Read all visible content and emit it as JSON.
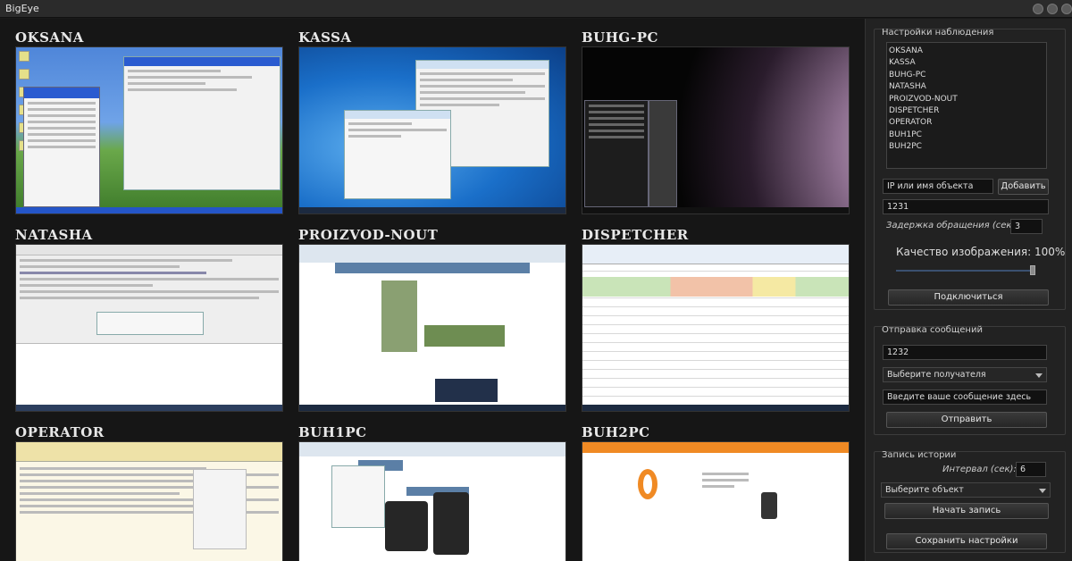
{
  "window": {
    "title": "BigEye"
  },
  "cameras": [
    {
      "name": "OKSANA",
      "style": "xp"
    },
    {
      "name": "KASSA",
      "style": "win7"
    },
    {
      "name": "BUHG-PC",
      "style": "space"
    },
    {
      "name": "NATASHA",
      "style": "doc"
    },
    {
      "name": "PROIZVOD-NOUT",
      "style": "web"
    },
    {
      "name": "DISPETCHER",
      "style": "sheet"
    },
    {
      "name": "OPERATOR",
      "style": "doc2"
    },
    {
      "name": "BUH1PC",
      "style": "web2"
    },
    {
      "name": "BUH2PC",
      "style": "ok"
    }
  ],
  "panel": {
    "observe": {
      "title": "Настройки наблюдения",
      "objects": [
        "OKSANA",
        "KASSA",
        "BUHG-PC",
        "NATASHA",
        "PROIZVOD-NOUT",
        "DISPETCHER",
        "OPERATOR",
        "BUH1PC",
        "BUH2PC"
      ],
      "ip_placeholder": "IP или имя объекта",
      "add_label": "Добавить",
      "port_value": "1231",
      "delay_label": "Задержка обращения (сек):",
      "delay_value": "3",
      "quality_label": "Качество изображения: 100%",
      "quality_value": 100,
      "connect_label": "Подключиться"
    },
    "messages": {
      "title": "Отправка сообщений",
      "port_value": "1232",
      "recipient_value": "Выберите получателя",
      "message_placeholder": "Введите ваше сообщение здесь",
      "send_label": "Отправить"
    },
    "history": {
      "title": "Запись истории",
      "interval_label": "Интервал (сек):",
      "interval_value": "6",
      "object_value": "Выберите объект",
      "record_label": "Начать запись"
    },
    "save_label": "Сохранить настройки"
  },
  "colors": {
    "accent": "#3a5070",
    "panel_bg": "#222222",
    "grid_bg": "#161616"
  }
}
